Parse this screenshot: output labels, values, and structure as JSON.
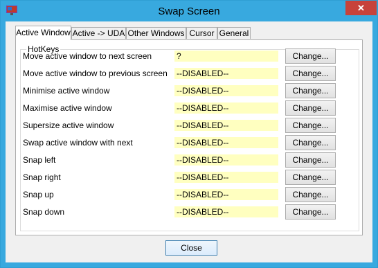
{
  "window": {
    "title": "Swap Screen",
    "close_glyph": "✕"
  },
  "tabs": [
    {
      "label": "Active Window",
      "active": true
    },
    {
      "label": "Active -> UDA",
      "active": false
    },
    {
      "label": "Other Windows",
      "active": false
    },
    {
      "label": "Cursor",
      "active": false
    },
    {
      "label": "General",
      "active": false
    }
  ],
  "hotkeys": {
    "group_label": "HotKeys",
    "change_label": "Change...",
    "rows": [
      {
        "label": "Move active window to next screen",
        "value": "?"
      },
      {
        "label": "Move active window to previous screen",
        "value": "--DISABLED--"
      },
      {
        "label": "Minimise active window",
        "value": "--DISABLED--"
      },
      {
        "label": "Maximise active window",
        "value": "--DISABLED--"
      },
      {
        "label": "Supersize active window",
        "value": "--DISABLED--"
      },
      {
        "label": "Swap active window with next",
        "value": "--DISABLED--"
      },
      {
        "label": "Snap left",
        "value": "--DISABLED--"
      },
      {
        "label": "Snap right",
        "value": "--DISABLED--"
      },
      {
        "label": "Snap up",
        "value": "--DISABLED--"
      },
      {
        "label": "Snap down",
        "value": "--DISABLED--"
      }
    ]
  },
  "footer": {
    "close_label": "Close"
  },
  "colors": {
    "titlebar": "#38a9df",
    "close_button": "#c7423b",
    "hotkey_field": "#ffffc0"
  }
}
